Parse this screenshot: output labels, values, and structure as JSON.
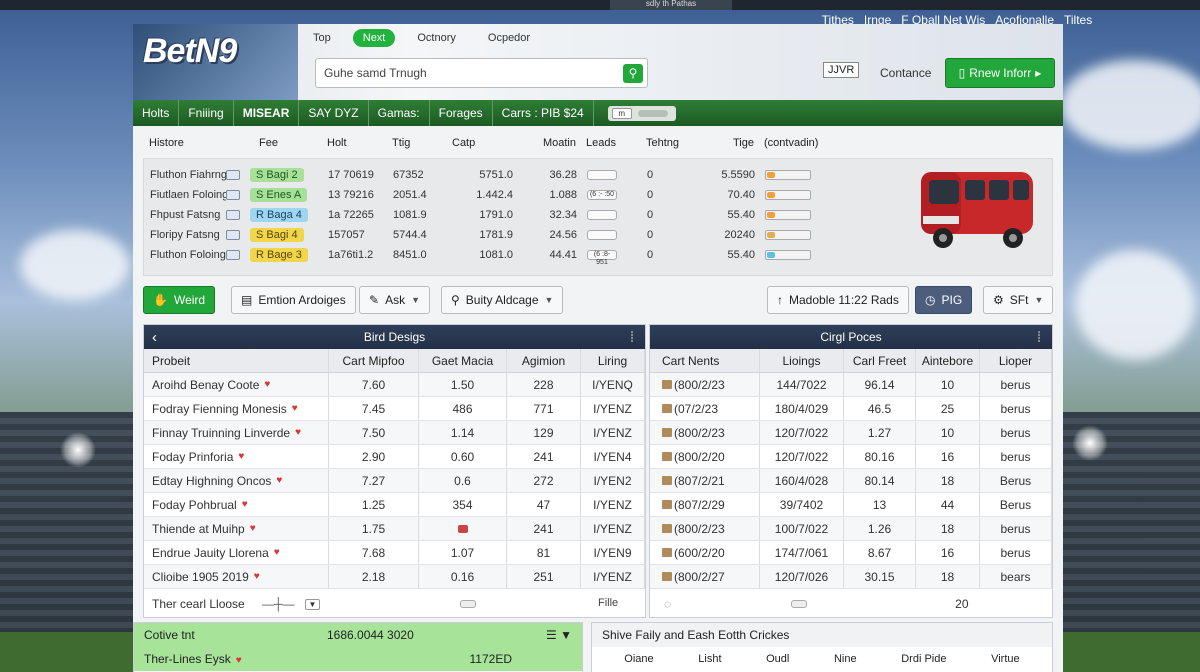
{
  "window": {
    "topbar_label": "sdly th Pathas",
    "top_links": [
      "Tithes",
      "Irnge",
      "F Oball Net Wis",
      "Acofionalle",
      "Tiltes"
    ]
  },
  "brand": {
    "logo": "BetN9"
  },
  "nav": {
    "tabs": [
      {
        "label": "Top",
        "active": false
      },
      {
        "label": "Next",
        "active": true
      },
      {
        "label": "Octnory",
        "active": false
      },
      {
        "label": "Ocpedor",
        "active": false
      }
    ]
  },
  "search": {
    "value": "Guhe samd Trnugh",
    "icon": "search-icon"
  },
  "header": {
    "badge": "JJVR",
    "link": "Contance",
    "cta_label": "Rnew Inforr"
  },
  "menu": {
    "items": [
      {
        "label": "Holts",
        "bold": false
      },
      {
        "label": "Fniiing",
        "bold": false
      },
      {
        "label": "MISEAR",
        "bold": true
      },
      {
        "label": "SAY DYZ",
        "bold": false
      },
      {
        "label": "Gamas:",
        "bold": false
      },
      {
        "label": "Forages",
        "bold": false
      },
      {
        "label": "Carrs : PIB $24",
        "bold": false
      }
    ],
    "toggle_label": "m"
  },
  "odds": {
    "headers": [
      "Histore",
      "Fee",
      "Holt",
      "Ttig",
      "Catp",
      "Moatin",
      "Leads",
      "Tehtng",
      "Tige",
      "(contvadin)"
    ],
    "rows": [
      {
        "name": "Fluthon Fiahrng",
        "chip": "S Bagi 2",
        "chip_color": "g",
        "v1": "17 70619",
        "v2": "67352",
        "v3": "5751.0",
        "v4": "36.28",
        "lead": "",
        "t": "0",
        "tige": "5.5590",
        "dot": "#f0a040"
      },
      {
        "name": "Fiutlaen Foloing",
        "chip": "S Enes A",
        "chip_color": "g",
        "v1": "13 79216",
        "v2": "2051.4",
        "v3": "1.442.4",
        "v4": "1.088",
        "lead": "(6 :- :50",
        "t": "0",
        "tige": "70.40",
        "dot": "#f0a040"
      },
      {
        "name": "Fhpust Fatsng",
        "chip": "R Baga 4",
        "chip_color": "b",
        "v1": "1a 72265",
        "v2": "1081.9",
        "v3": "1791.0",
        "v4": "32.34",
        "lead": "",
        "t": "0",
        "tige": "55.40",
        "dot": "#f0a040"
      },
      {
        "name": "Floripy Fatsng",
        "chip": "S Bagi 4",
        "chip_color": "y",
        "v1": "157057",
        "v2": "5744.4",
        "v3": "1781.9",
        "v4": "24.56",
        "lead": "",
        "t": "0",
        "tige": "20240",
        "dot": "#e0b050"
      },
      {
        "name": "Fluthon Foloing",
        "chip": "R Bage 3",
        "chip_color": "y",
        "v1": "1a76ti1.2",
        "v2": "8451.0",
        "v3": "1081.0",
        "v4": "44.41",
        "lead": "(6 :8-951",
        "t": "0",
        "tige": "55.40",
        "dot": "#60c0e0"
      }
    ]
  },
  "toolbar": {
    "weird": "Weird",
    "emtion": "Emtion Ardoiges",
    "ask": "Ask",
    "buity": "Buity Aldcage",
    "madoble": "Madoble 11:22 Rads",
    "pig": "PIG",
    "sft": "SFt"
  },
  "left_grid": {
    "title": "Bird Desigs",
    "headers": [
      "Probeit",
      "Cart Mipfoo",
      "Gaet Macia",
      "Agimion",
      "Liring"
    ],
    "rows": [
      [
        "Aroihd Benay Coote",
        "7.60",
        "1.50",
        "228",
        "I/YENQ"
      ],
      [
        "Fodray Fienning Monesis",
        "7.45",
        "486",
        "771",
        "I/YENZ"
      ],
      [
        "Finnay Truinning Linverde",
        "7.50",
        "1.14",
        "129",
        "I/YENZ"
      ],
      [
        "Foday Prinforia",
        "2.90",
        "0.60",
        "241",
        "I/YEN4"
      ],
      [
        "Edtay Highning Oncos",
        "7.27",
        "0.6",
        "272",
        "I/YEN2"
      ],
      [
        "Foday Pohbrual",
        "1.25",
        "354",
        "47",
        "I/YENZ"
      ],
      [
        "Thiende at Muihp",
        "1.75",
        "",
        "241",
        "I/YENZ"
      ],
      [
        "Endrue Jauity Llorena",
        "7.68",
        "1.07",
        "81",
        "I/YEN9"
      ],
      [
        "Clioibe 1905 2019",
        "2.18",
        "0.16",
        "251",
        "I/YENZ"
      ]
    ],
    "footer": "Ther cearl Lloose"
  },
  "right_grid": {
    "title": "Cirgl Poces",
    "headers": [
      "Cart Nents",
      "Lioings",
      "Carl Freet",
      "Aintebore",
      "Lioper"
    ],
    "rows": [
      [
        "(800/2/23",
        "144/7022",
        "96.14",
        "10",
        "berus"
      ],
      [
        "(07/2/23",
        "180/4/029",
        "46.5",
        "25",
        "berus"
      ],
      [
        "(800/2/23",
        "120/7/022",
        "1.27",
        "10",
        "berus"
      ],
      [
        "(800/2/20",
        "120/7/022",
        "80.16",
        "16",
        "berus"
      ],
      [
        "(807/2/21",
        "160/4/028",
        "80.14",
        "18",
        "Berus"
      ],
      [
        "(807/2/29",
        "39/7402",
        "13",
        "44",
        "Berus"
      ],
      [
        "(800/2/23",
        "100/7/022",
        "1.26",
        "18",
        "berus"
      ],
      [
        "(600/2/20",
        "174/7/061",
        "8.67",
        "16",
        "berus"
      ],
      [
        "(800/2/27",
        "120/7/026",
        "30.15",
        "18",
        "bears"
      ]
    ],
    "footer_mid": "Fille",
    "footer_count": "20"
  },
  "card_left": {
    "title": "Cotive tnt",
    "value": "1686.0044 3020",
    "row_label": "Ther-Lines Eysk",
    "row_value": "1172ED"
  },
  "card_right": {
    "title": "Shive Faily and Eash Eotth Crickes",
    "headers": [
      "Oiane",
      "Lisht",
      "Oudl",
      "Nine",
      "Drdi Pide",
      "Virtue"
    ]
  }
}
